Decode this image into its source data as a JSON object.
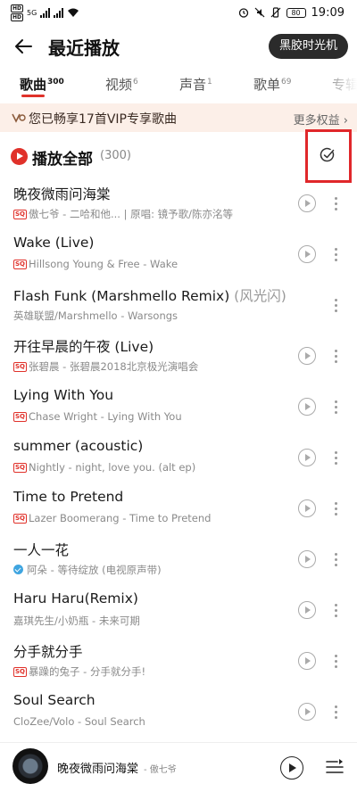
{
  "status_bar": {
    "sim1": "HD",
    "sim2": "HD",
    "net": "5G",
    "battery": "80",
    "time": "19:09"
  },
  "header": {
    "title": "最近播放",
    "vinyl_button": "黑胶时光机"
  },
  "tabs": [
    {
      "label": "歌曲",
      "count": "300",
      "active": true
    },
    {
      "label": "视频",
      "count": "6"
    },
    {
      "label": "声音",
      "count": "1"
    },
    {
      "label": "歌单",
      "count": "69"
    },
    {
      "label": "专辑",
      "count": ""
    }
  ],
  "vip_banner": {
    "text": "您已畅享17首VIP专享歌曲",
    "more": "更多权益 ›"
  },
  "play_all": {
    "label": "播放全部",
    "count": "(300)"
  },
  "songs": [
    {
      "title": "晚夜微雨问海棠",
      "alias": "",
      "badge": "SQ",
      "subtitle": "傲七爷 - 二哈和他... | 原唱: 镜予歌/陈亦洺等"
    },
    {
      "title": "Wake (Live)",
      "alias": "",
      "badge": "SQ",
      "subtitle": "Hillsong Young & Free - Wake"
    },
    {
      "title": "Flash Funk (Marshmello Remix)",
      "alias": " (风光闪)",
      "badge": "",
      "subtitle": "英雄联盟/Marshmello - Warsongs"
    },
    {
      "title": "开往早晨的午夜 (Live)",
      "alias": "",
      "badge": "SQ",
      "subtitle": "张碧晨 - 张碧晨2018北京极光演唱会"
    },
    {
      "title": "Lying With You",
      "alias": "",
      "badge": "SQ",
      "subtitle": "Chase Wright - Lying With You"
    },
    {
      "title": "summer (acoustic)",
      "alias": "",
      "badge": "SQ",
      "subtitle": "Nightly - night, love you. (alt ep)"
    },
    {
      "title": "Time to Pretend",
      "alias": "",
      "badge": "SQ",
      "subtitle": "Lazer Boomerang - Time to Pretend"
    },
    {
      "title": "一人一花",
      "alias": "",
      "badge": "verified",
      "subtitle": "阿朵 - 等待绽放 (电视原声带)"
    },
    {
      "title": "Haru Haru(Remix)",
      "alias": "",
      "badge": "",
      "subtitle": "嘉琪先生/小奶瓶 - 未来可期"
    },
    {
      "title": "分手就分手",
      "alias": "",
      "badge": "SQ",
      "subtitle": "暴躁的兔子 - 分手就分手!"
    },
    {
      "title": "Soul Search",
      "alias": "",
      "badge": "",
      "subtitle": "CloZee/Volo - Soul Search"
    }
  ],
  "now_playing": {
    "title": "晚夜微雨问海棠",
    "artist": "- 傲七爷"
  },
  "colors": {
    "accent": "#e0312a",
    "vip_bg": "#fcefe8",
    "highlight_box": "#e0272a"
  },
  "icons": [
    "back-arrow-icon",
    "vip-icon",
    "play-all-icon",
    "multi-select-check-icon",
    "play-circle-icon",
    "more-vertical-icon",
    "playlist-icon"
  ]
}
